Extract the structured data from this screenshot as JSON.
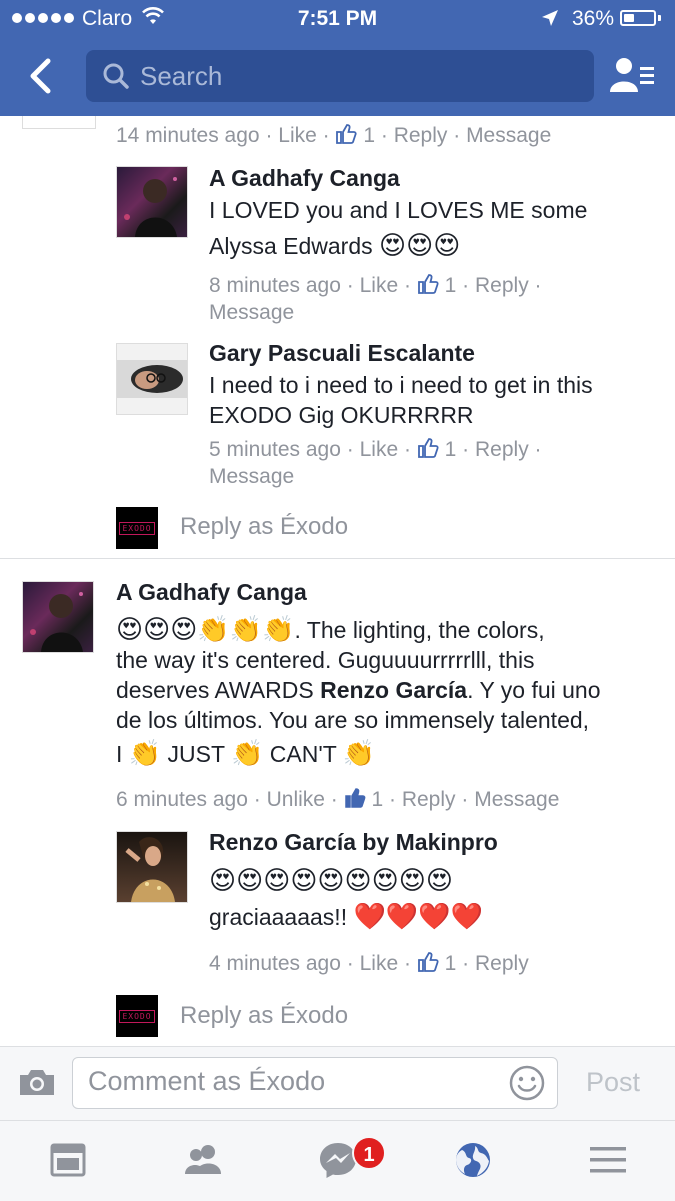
{
  "status_bar": {
    "carrier": "Claro",
    "time": "7:51 PM",
    "battery_percent": "36%",
    "battery_level": 0.36
  },
  "header": {
    "search_placeholder": "Search"
  },
  "thread": {
    "top_meta": {
      "time": "14 minutes ago",
      "like": "Like",
      "likes": "1",
      "reply": "Reply",
      "message": "Message"
    },
    "replies": [
      {
        "name": "A Gadhafy Canga",
        "text_line1": "I LOVED you and I LOVES ME some",
        "text_line2": "Alyssa Edwards",
        "emojis": "😍😍😍",
        "time": "8 minutes ago",
        "like": "Like",
        "likes": "1",
        "reply": "Reply",
        "message": "Message"
      },
      {
        "name": "Gary Pascuali Escalante",
        "text_line1": "I need to i need to i need to get in this",
        "text_line2": "EXODO Gig OKURRRRR",
        "time": "5 minutes ago",
        "like": "Like",
        "likes": "1",
        "reply": "Reply",
        "message": "Message"
      }
    ],
    "reply_as": "Reply as Éxodo",
    "logo_text": "EXODO"
  },
  "comment": {
    "name": "A Gadhafy Canga",
    "line1_emojis": "😍😍😍👏👏👏",
    "line1_text": ". The lighting, the colors,",
    "line2": "the way it's centered. Guguuuurrrrrlll, this",
    "line3_pre": "deserves AWARDS ",
    "line3_mention": "Renzo García",
    "line3_post": ". Y yo fui uno",
    "line4": "de los últimos. You are so immensely talented,",
    "line5": {
      "i": "I",
      "w1": "JUST",
      "w2": "CAN'T",
      "clap": "👏"
    },
    "time": "6 minutes ago",
    "unlike": "Unlike",
    "likes": "1",
    "reply": "Reply",
    "message": "Message"
  },
  "sub_reply": {
    "name": "Renzo García  by Makinpro",
    "emojis": "😍😍😍😍😍😍😍😍😍",
    "text": "graciaaaaas!!",
    "hearts": "❤️❤️❤️❤️",
    "time": "4 minutes ago",
    "like": "Like",
    "likes": "1",
    "reply": "Reply"
  },
  "reply_as_2": "Reply as Éxodo",
  "composer": {
    "placeholder": "Comment as Éxodo",
    "post": "Post"
  },
  "tabbar": {
    "messenger_badge": "1"
  },
  "colors": {
    "header": "#4267b2",
    "link_blue": "#4267b2",
    "meta_gray": "#90949c",
    "badge_red": "#e02020"
  }
}
